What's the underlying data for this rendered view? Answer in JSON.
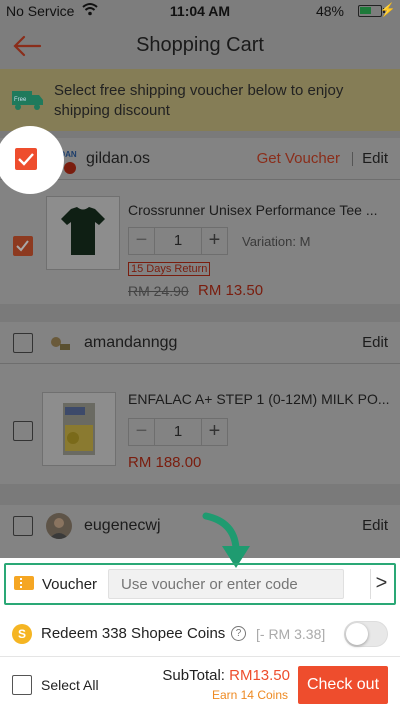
{
  "status_bar": {
    "carrier": "No Service",
    "time": "11:04 AM",
    "battery": "48%"
  },
  "header": {
    "title": "Shopping Cart"
  },
  "shipping_banner": {
    "text": "Select free shipping voucher below to enjoy shipping discount"
  },
  "shops": [
    {
      "name": "gildan.os",
      "get_voucher": "Get Voucher",
      "edit": "Edit",
      "checked": true,
      "item": {
        "name": "Crossrunner Unisex Performance Tee ...",
        "quantity": "1",
        "variation": "Variation: M",
        "badge": "15 Days Return",
        "old_price": "RM 24.90",
        "price": "RM 13.50"
      }
    },
    {
      "name": "amandanngg",
      "edit": "Edit",
      "checked": false,
      "item": {
        "name": "ENFALAC A+ STEP 1 (0-12M) MILK PO...",
        "quantity": "1",
        "price": "RM 188.00"
      }
    },
    {
      "name": "eugenecwj",
      "edit": "Edit",
      "checked": false
    }
  ],
  "voucher": {
    "label": "Voucher",
    "placeholder": "Use voucher or enter code",
    "chevron": ">"
  },
  "coins": {
    "label": "Redeem 338 Shopee Coins",
    "help": "?",
    "value": "[- RM 3.38]",
    "enabled": false
  },
  "checkout": {
    "select_all": "Select All",
    "subtotal_label": "SubTotal:",
    "subtotal_amount": "RM13.50",
    "earn": "Earn 14 Coins",
    "button": "Check out"
  },
  "colors": {
    "accent": "#ee4d2d",
    "highlight": "#2aa876",
    "coin": "#f5b523"
  }
}
